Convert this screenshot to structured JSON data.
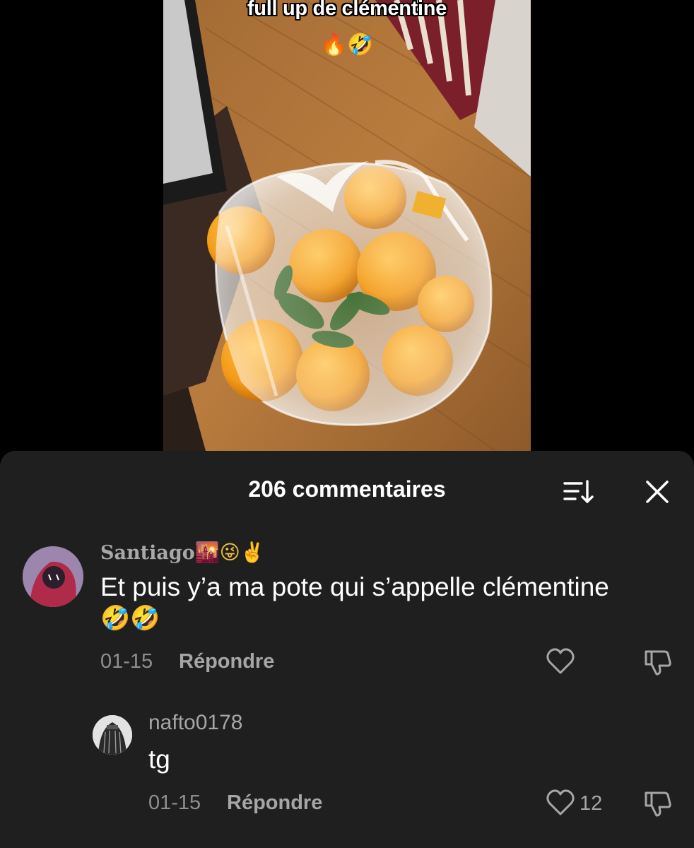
{
  "video": {
    "caption": "full up de clémentine",
    "caption_emoji": "🔥🤣"
  },
  "sheet": {
    "title": "206 commentaires",
    "sort_icon": "sort-icon",
    "close_icon": "close-icon"
  },
  "comments": [
    {
      "username": "Santiago",
      "username_emoji": "🌇😜✌️",
      "text": "Et puis y’a ma pote qui s’appelle clémentine",
      "text_emoji": "🤣🤣",
      "date": "01-15",
      "reply_label": "Répondre",
      "like_count": ""
    },
    {
      "username": "nafto0178",
      "text": "tg",
      "date": "01-15",
      "reply_label": "Répondre",
      "like_count": "12"
    }
  ],
  "colors": {
    "sheet_bg": "#1f1f1f",
    "primary_text": "#ffffff",
    "secondary_text": "#a6a6a6",
    "background": "#000000"
  }
}
